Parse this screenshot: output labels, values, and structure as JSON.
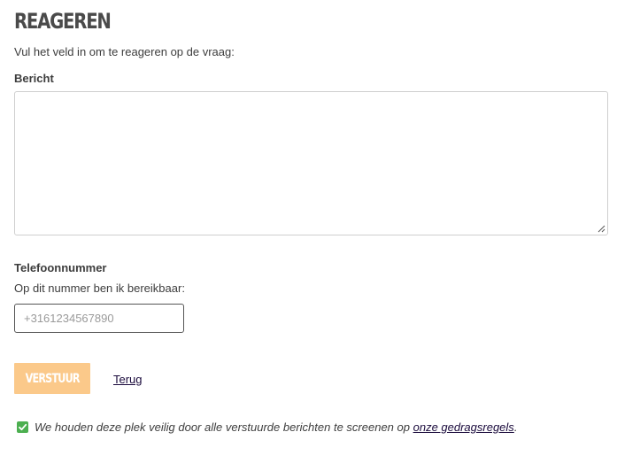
{
  "form": {
    "title": "REAGEREN",
    "intro": "Vul het veld in om te reageren op de vraag:",
    "message_label": "Bericht",
    "message_value": "",
    "phone_label": "Telefoonnummer",
    "phone_hint": "Op dit nummer ben ik bereikbaar:",
    "phone_placeholder": "+3161234567890",
    "phone_value": "",
    "submit_label": "VERSTUUR",
    "back_label": "Terug"
  },
  "notice": {
    "text": "We houden deze plek veilig door alle verstuurde berichten te screenen op ",
    "link_label": "onze gedragsregels",
    "suffix": "."
  },
  "icons": {
    "notice_icon": "checkmark-box-icon",
    "resize_icon": "resize-handle-icon"
  },
  "colors": {
    "submit_button": "#fbc98a",
    "check_icon": "#4caf50",
    "link": "#1a0a3c"
  }
}
